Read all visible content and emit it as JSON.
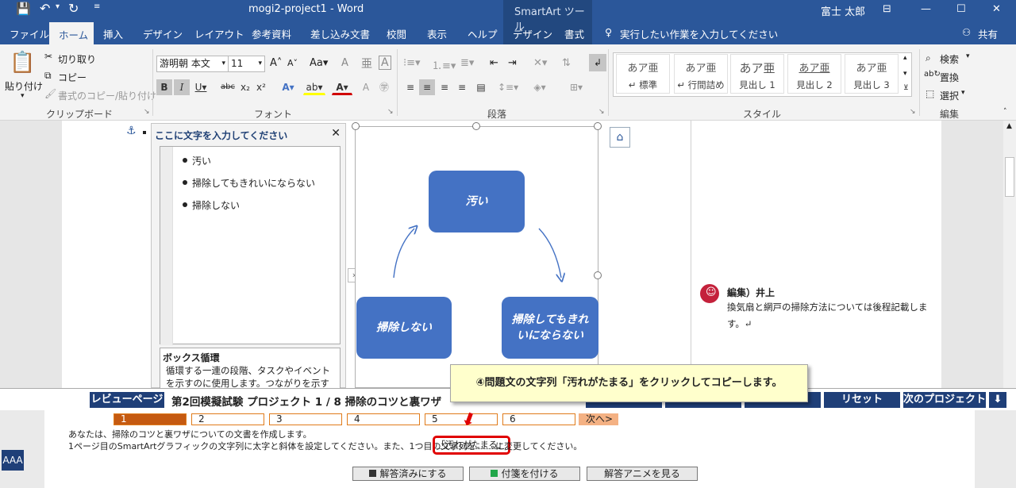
{
  "titlebar": {
    "doc_title": "mogi2-project1  -  Word",
    "tools_label": "SmartArt ツール",
    "user": "富士 太郎"
  },
  "tabs": [
    "ファイル",
    "ホーム",
    "挿入",
    "デザイン",
    "レイアウト",
    "参考資料",
    "差し込み文書",
    "校閲",
    "表示",
    "ヘルプ",
    "デザイン",
    "書式"
  ],
  "tell_me": "実行したい作業を入力してください",
  "share": "共有",
  "clipboard": {
    "paste": "貼り付け",
    "cut": "切り取り",
    "copy": "コピー",
    "format_painter": "書式のコピー/貼り付け",
    "label": "クリップボード"
  },
  "font": {
    "name": "游明朝 本文",
    "size": "11",
    "label": "フォント"
  },
  "paragraph": {
    "label": "段落"
  },
  "styles": {
    "items": [
      {
        "sample": "あア亜",
        "name": "↵ 標準"
      },
      {
        "sample": "あア亜",
        "name": "↵ 行間詰め"
      },
      {
        "sample": "あア亜",
        "name": "見出し 1"
      },
      {
        "sample": "あア亜",
        "name": "見出し 2"
      },
      {
        "sample": "あア亜",
        "name": "見出し 3"
      }
    ],
    "label": "スタイル"
  },
  "editing": {
    "find": "検索",
    "replace": "置換",
    "select": "選択",
    "label": "編集"
  },
  "textpane": {
    "title": "ここに文字を入力してください",
    "bullets": [
      "汚い",
      "掃除してもきれいにならない",
      "掃除しない"
    ],
    "desc_title": "ボックス循環",
    "desc_body": "循環する一連の段階、タスクやイベントを示すのに使用します。つながりを示す矢印やフロー"
  },
  "smartart": {
    "nodes": [
      "汚い",
      "掃除してもきれいにならない",
      "掃除しない"
    ]
  },
  "comment": {
    "author": "編集）井上",
    "body": "換気扇と網戸の掃除方法については後程記載します。↵"
  },
  "review": {
    "page_label": "レビューページ",
    "title": "第2回模擬試験 プロジェクト 1 / 8 掃除のコツと裏ワザ",
    "reset": "リセット",
    "next_project": "次のプロジェクト"
  },
  "tooltip": "④問題文の文字列「汚れがたまる」をクリックしてコピーします。",
  "pages": [
    "1",
    "2",
    "3",
    "4",
    "5",
    "6"
  ],
  "next": "次へ>",
  "task": {
    "line1": "あなたは、掃除のコツと裏ワザについての文書を作成します。",
    "line2_a": "1ページ目のSmartArtグラフィックの文字列に太字と斜体を設定してください。また、1つ目の文字列を",
    "line2_highlight": "「汚れがたまる」",
    "line2_b": "に変更してください。"
  },
  "buttons": {
    "done": "解答済みにする",
    "tag": "付箋を付ける",
    "anim": "解答アニメを見る"
  },
  "font_size_toggle": "AAA"
}
